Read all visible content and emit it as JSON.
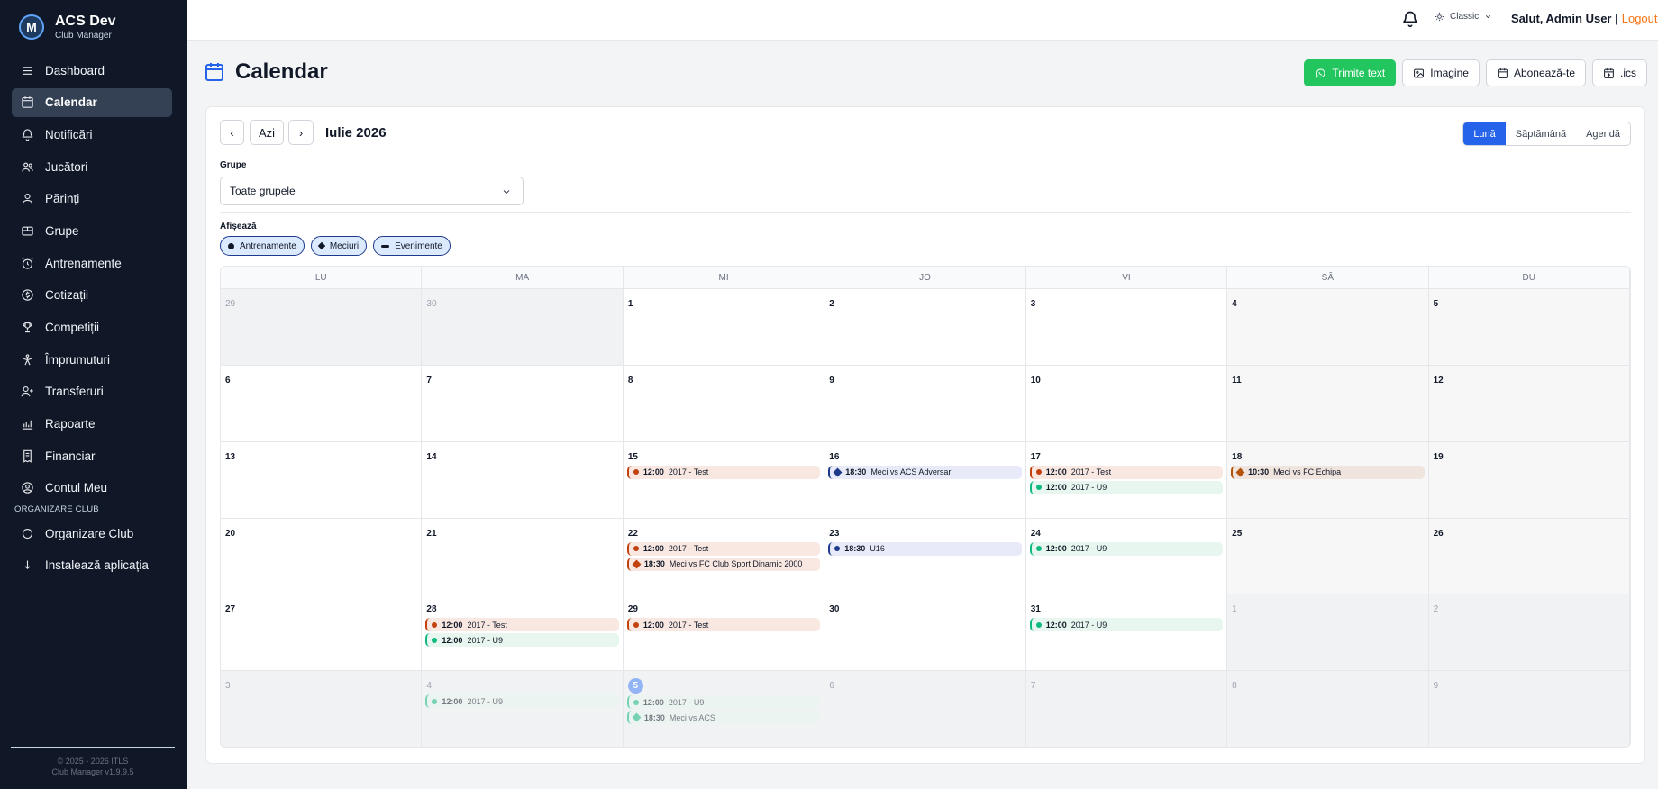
{
  "app": {
    "name": "ACS Dev",
    "subtitle": "Club Manager"
  },
  "sidebar": {
    "items": [
      {
        "label": "Dashboard",
        "icon": "menu-icon"
      },
      {
        "label": "Calendar",
        "icon": "calendar-icon",
        "active": true
      },
      {
        "label": "Notificări",
        "icon": "bell-icon"
      },
      {
        "label": "Jucători",
        "icon": "users-icon"
      },
      {
        "label": "Părinți",
        "icon": "user-icon"
      },
      {
        "label": "Grupe",
        "icon": "group-icon"
      },
      {
        "label": "Antrenamente",
        "icon": "clock-icon"
      },
      {
        "label": "Cotizații",
        "icon": "coin-icon"
      },
      {
        "label": "Competiții",
        "icon": "trophy-icon"
      },
      {
        "label": "Împrumuturi",
        "icon": "handshake-icon"
      },
      {
        "label": "Transferuri",
        "icon": "user-plus-icon"
      },
      {
        "label": "Rapoarte",
        "icon": "chart-icon"
      },
      {
        "label": "Financiar",
        "icon": "receipt-icon"
      },
      {
        "label": "Contul Meu",
        "icon": "account-icon"
      }
    ],
    "section_label": "ORGANIZARE CLUB",
    "section_items": [
      {
        "label": "Organizare Club",
        "icon": "circle-icon"
      },
      {
        "label": "Instalează aplicația",
        "icon": "download-icon"
      }
    ],
    "footer_line1": "© 2025 - 2026 ITLS",
    "footer_line2": "Club Manager v1.9.9.5"
  },
  "topbar": {
    "theme_label": "Classic",
    "greeting": "Salut, Admin User |",
    "logout": "Logout"
  },
  "page": {
    "title": "Calendar"
  },
  "actions": [
    {
      "label": "Trimite text",
      "icon": "whatsapp-icon",
      "primary": true
    },
    {
      "label": "Imagine",
      "icon": "image-icon"
    },
    {
      "label": "Abonează-te",
      "icon": "calendar-icon"
    },
    {
      "label": ".ics",
      "icon": "calendar-plus-icon"
    }
  ],
  "toolbar": {
    "prev": "‹",
    "today": "Azi",
    "next": "›",
    "month_label": "Iulie 2026"
  },
  "views": [
    {
      "label": "Lună",
      "active": true
    },
    {
      "label": "Săptămână"
    },
    {
      "label": "Agendă"
    }
  ],
  "filters": {
    "groups_label": "Grupe",
    "groups_value": "Toate grupele",
    "show_label": "Afișează",
    "chips": [
      {
        "label": "Antrenamente",
        "shape": "dot"
      },
      {
        "label": "Meciuri",
        "shape": "diamond"
      },
      {
        "label": "Evenimente",
        "shape": "bar"
      }
    ]
  },
  "calendar": {
    "weekdays": [
      "LU",
      "MA",
      "MI",
      "JO",
      "VI",
      "SÂ",
      "DU"
    ],
    "colors": {
      "training": "#c2410c",
      "u9": "#10b981",
      "match": "#1e3a8a",
      "match_away": "#b45309",
      "today": "#93b4f5"
    },
    "weeks": [
      [
        {
          "d": "29",
          "out": true
        },
        {
          "d": "30",
          "out": true
        },
        {
          "d": "1"
        },
        {
          "d": "2"
        },
        {
          "d": "3"
        },
        {
          "d": "4"
        },
        {
          "d": "5"
        }
      ],
      [
        {
          "d": "6"
        },
        {
          "d": "7"
        },
        {
          "d": "8"
        },
        {
          "d": "9"
        },
        {
          "d": "10"
        },
        {
          "d": "11"
        },
        {
          "d": "12"
        }
      ],
      [
        {
          "d": "13"
        },
        {
          "d": "14"
        },
        {
          "d": "15",
          "events": [
            {
              "time": "12:00",
              "title": "2017 - Test",
              "kind": "training",
              "shape": "dot"
            }
          ]
        },
        {
          "d": "16",
          "events": [
            {
              "time": "18:30",
              "title": "Meci vs ACS Adversar",
              "kind": "match",
              "shape": "diamond"
            }
          ]
        },
        {
          "d": "17",
          "events": [
            {
              "time": "12:00",
              "title": "2017 - Test",
              "kind": "training",
              "shape": "dot"
            },
            {
              "time": "12:00",
              "title": "2017 - U9",
              "kind": "u9",
              "shape": "dot"
            }
          ]
        },
        {
          "d": "18",
          "events": [
            {
              "time": "10:30",
              "title": "Meci vs FC Echipa",
              "kind": "match2",
              "shape": "diamond"
            }
          ]
        },
        {
          "d": "19"
        }
      ],
      [
        {
          "d": "20"
        },
        {
          "d": "21"
        },
        {
          "d": "22",
          "events": [
            {
              "time": "12:00",
              "title": "2017 - Test",
              "kind": "training",
              "shape": "dot"
            },
            {
              "time": "18:30",
              "title": "Meci vs FC Club Sport Dinamic 2000",
              "kind": "matchr",
              "shape": "diamond"
            }
          ]
        },
        {
          "d": "23",
          "events": [
            {
              "time": "18:30",
              "title": "U16",
              "kind": "match",
              "shape": "dot"
            }
          ]
        },
        {
          "d": "24",
          "events": [
            {
              "time": "12:00",
              "title": "2017 - U9",
              "kind": "u9",
              "shape": "dot"
            }
          ]
        },
        {
          "d": "25"
        },
        {
          "d": "26"
        }
      ],
      [
        {
          "d": "27"
        },
        {
          "d": "28",
          "events": [
            {
              "time": "12:00",
              "title": "2017 - Test",
              "kind": "training",
              "shape": "dot"
            },
            {
              "time": "12:00",
              "title": "2017 - U9",
              "kind": "u9",
              "shape": "dot"
            }
          ]
        },
        {
          "d": "29",
          "events": [
            {
              "time": "12:00",
              "title": "2017 - Test",
              "kind": "training",
              "shape": "dot"
            }
          ]
        },
        {
          "d": "30"
        },
        {
          "d": "31",
          "events": [
            {
              "time": "12:00",
              "title": "2017 - U9",
              "kind": "u9",
              "shape": "dot"
            }
          ]
        },
        {
          "d": "1",
          "out": true
        },
        {
          "d": "2",
          "out": true
        }
      ],
      [
        {
          "d": "3",
          "out": true
        },
        {
          "d": "4",
          "out": true,
          "events": [
            {
              "time": "12:00",
              "title": "2017 - U9",
              "kind": "u9",
              "shape": "dot"
            }
          ]
        },
        {
          "d": "5",
          "out": true,
          "today": true,
          "events": [
            {
              "time": "12:00",
              "title": "2017 - U9",
              "kind": "u9",
              "shape": "dot"
            },
            {
              "time": "18:30",
              "title": "Meci vs ACS",
              "kind": "u9",
              "shape": "diamond"
            }
          ]
        },
        {
          "d": "6",
          "out": true
        },
        {
          "d": "7",
          "out": true
        },
        {
          "d": "8",
          "out": true
        },
        {
          "d": "9",
          "out": true
        }
      ]
    ]
  }
}
